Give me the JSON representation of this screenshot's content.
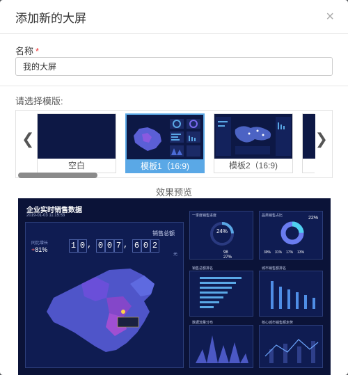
{
  "header": {
    "title": "添加新的大屏",
    "close": "×"
  },
  "form": {
    "name_label": "名称",
    "required_mark": "*",
    "name_value": "我的大屏"
  },
  "templates": {
    "label": "请选择模版:",
    "items": [
      {
        "label": "空白",
        "selected": false
      },
      {
        "label": "模板1（16:9)",
        "selected": true
      },
      {
        "label": "模板2（16:9)",
        "selected": false
      }
    ],
    "prev_arrow": "❮",
    "next_arrow": "❯"
  },
  "preview": {
    "label": "效果预览",
    "dashboard_title": "企业实时销售数据",
    "date": "2019-01-03 11:15:53",
    "total_label": "销售总额",
    "growth_label": "同比增长",
    "growth_value": "81%",
    "digits": [
      "1",
      "0",
      ",",
      "0",
      "0",
      "7",
      ",",
      "6",
      "0",
      "2"
    ],
    "unit": "元",
    "panels": {
      "top_right_1": "一季度销售进度",
      "top_right_2": "品类销售占比",
      "ring1_value": "24%",
      "ring2_value": "22%",
      "rank_title": "销售总额排名",
      "city_title": "城市销售额排名",
      "dist_title": "数据流量分布",
      "core_title": "核心城市销售额走势"
    },
    "stats": [
      "98",
      "27%",
      "39%",
      "31%",
      "17%",
      "13%"
    ]
  },
  "colors": {
    "accent": "#5aa8e6",
    "dark_bg": "#0b1338",
    "panel_bg": "#0f1c52"
  }
}
